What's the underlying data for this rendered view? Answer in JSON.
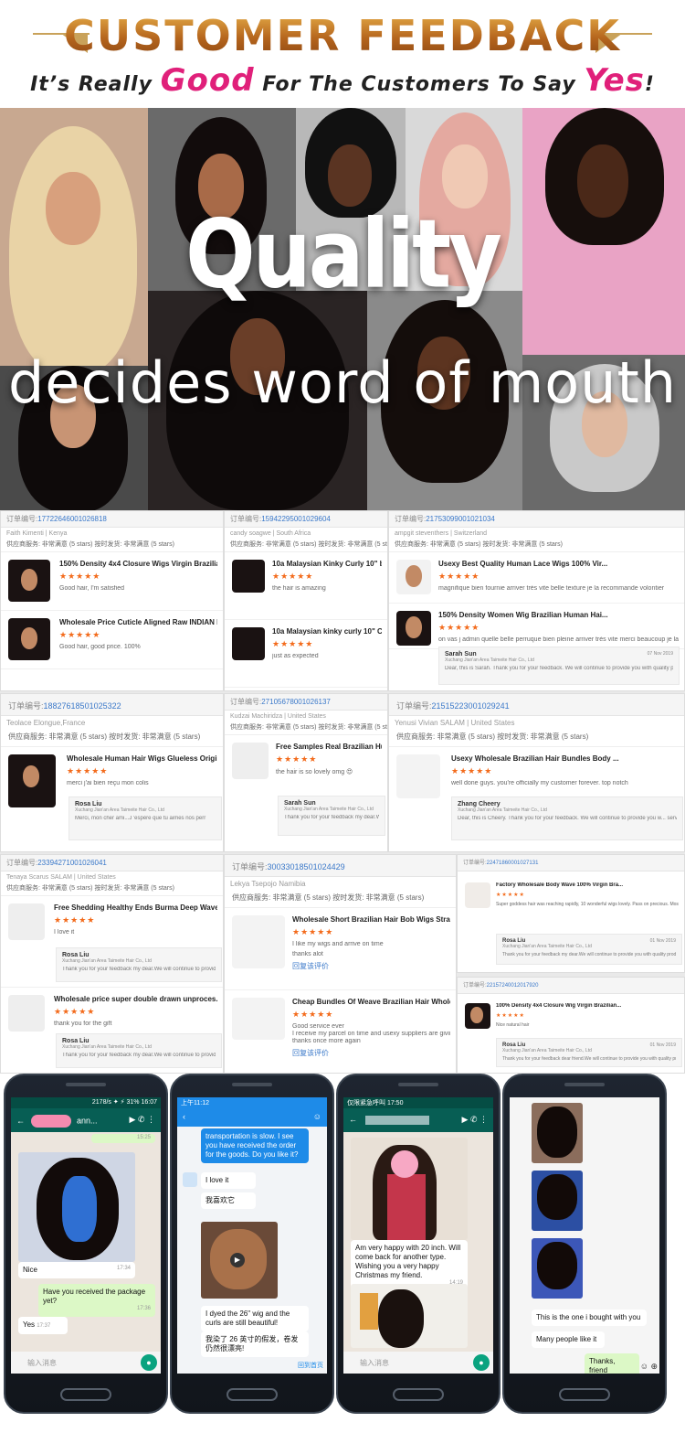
{
  "header": {
    "title": "CUSTOMER FEEDBACK",
    "subtitle_pre": "It’s Really ",
    "subtitle_em1": "Good",
    "subtitle_mid": " For The Customers To Say ",
    "subtitle_em2": "Yes",
    "subtitle_end": "!"
  },
  "hero": {
    "headline": "Quality",
    "tagline": "decides word of mouth"
  },
  "colors": {
    "accent_gold": "#c9a25a",
    "accent_pink": "#e0207a",
    "star": "#f36b1c",
    "link": "#3a78c9"
  },
  "stars": "★★★★★",
  "reviews": {
    "c1": {
      "order_label": "订单编号:",
      "order_no": "17722646001026818",
      "buyer": "Faith Kimenti | Kenya",
      "rating_row": "供应商服务: 非常满意  (5 stars)     按时发货: 非常满意  (5 stars)",
      "items": [
        {
          "title": "150% Density 4x4 Closure Wigs Virgin Brazilian...",
          "comment": "Good hair, I'm satisfied"
        },
        {
          "title": "Wholesale Price Cuticle Aligned Raw INDIAN H...",
          "comment": "Good hair, good price. 100%"
        }
      ]
    },
    "c2": {
      "order_label": "订单编号:",
      "order_no": "15942295001029604",
      "buyer": "candy soagwe | South Africa",
      "rating_row": "供应商服务: 非常满意  (5 stars)     按时发货: 非常满意  (5 stars)",
      "items": [
        {
          "title": "10a Malaysian Kinky Curly 10\" bundles",
          "comment": "the hair is amazing"
        },
        {
          "title": "10a Malaysian kinky curly 10\" Closure",
          "comment": "just as expected"
        }
      ]
    },
    "c3": {
      "order_label": "订单编号:",
      "order_no": "21753099001021034",
      "buyer": "ampgit steventhers | Switzerland",
      "rating_row": "供应商服务: 非常满意  (5 stars)     按时发货: 非常满意  (5 stars)",
      "items": [
        {
          "title": "Usexy Best Quality Human Lace Wigs 100% Vir...",
          "comment": "magnifique bien fournie arriver très vite belle texture je la recommande volontier"
        },
        {
          "title": "150% Density Women Wig Brazilian Human Hai...",
          "comment": "on vas j admin quelle belle perruque bien pleine arriver très vite merci beaucoup je la recommande très très volontier à bientôt"
        }
      ],
      "reply": {
        "name": "Sarah Sun",
        "company": "Xuchang Jian'an Area Taimeite Hair Co., Ltd",
        "date": "07 Nov 2019",
        "text": "Dear, this is Sarah. Thank you for your feedback. We will continue to provide you with quality products and services. Have a happy life."
      }
    },
    "c4": {
      "order_label": "订单编号:",
      "order_no": "18827618501025322",
      "buyer": "Teolace Elongue,France",
      "rating_row": "供应商服务: 非常满意  (5 stars)     按时发货: 非常满意  (5 stars)",
      "item": {
        "title": "Wholesale Human Hair Wigs Glueless Original ...",
        "comment": "merci j'ai bien reçu mon colis"
      },
      "reply": {
        "name": "Rosa Liu",
        "company": "Xuchang Jian'an Area Taimeite Hair Co., Ltd",
        "text": "Merci, mon cher ami...J 'espère que tu aimes nos perr"
      }
    },
    "c5": {
      "order_label": "订单编号:",
      "order_no": "27105678001026137",
      "buyer": "Kudzai Machiridza | United States",
      "rating_row": "供应商服务: 非常满意  (5 stars)     按时发货: 非常满意  (5 stars)",
      "item": {
        "title": "Free Samples Real Brazilian Human Hair Bu...",
        "comment": "the hair is so lovely omg 😍"
      },
      "reply": {
        "name": "Sarah Sun",
        "company": "Xuchang Jian'an Area Taimeite Hair Co., Ltd",
        "text": "Thank you for your feedback my dear.We will co... Have a happy life."
      }
    },
    "c6": {
      "order_label": "订单编号:",
      "order_no": "21515223001029241",
      "buyer": "Yenusi Vivian SALAM | United States",
      "rating_row": "供应商服务: 非常满意  (5 stars)     按时发货: 非常满意  (5 stars)",
      "item": {
        "title": "Usexy Wholesale Brazilian Hair Bundles Body ...",
        "comment": "well done guys. you're officially my customer forever. top notch"
      },
      "reply": {
        "name": "Zhang Cheery",
        "company": "Xuchang Jian'an Area Taimeite Hair Co., Ltd",
        "text": "Dear, this is Cheery. Thank you for your feedback. We will continue to provide you w... services. Have a happy life."
      }
    },
    "c7": {
      "order_label": "订单编号:",
      "order_no": "23394271001026041",
      "buyer": "Tenaya Scarus SALAM | United States",
      "rating_row": "供应商服务: 非常满意  (5 stars)     按时发货: 非常满意  (5 stars)",
      "items": [
        {
          "title": "Free Shedding Healthy Ends Burma Deep Wave...",
          "comment": "I love it"
        },
        {
          "title": "Wholesale price super double drawn unproces...",
          "comment": "thank you for the gift"
        }
      ],
      "reply1": {
        "name": "Rosa Liu",
        "company": "Xuchang Jian'an Area Taimeite Hair Co., Ltd",
        "text": "Thank you for your feedback my dear.We will continue to provide you with q... a happy life."
      },
      "reply2": {
        "name": "Rosa Liu",
        "company": "Xuchang Jian'an Area Taimeite Hair Co., Ltd",
        "text": "Thank you for your feedback my dear.We will continue to provide you with q... Have a happy life."
      }
    },
    "c8": {
      "order_label": "订单编号:",
      "order_no": "30033018501024429",
      "buyer": "Lekya Tsepojo Namibia",
      "rating_row": "供应商服务: 非常满意  (5 stars)     按时发货: 非常满意  (5 stars)",
      "items": [
        {
          "title": "Wholesale Short Brazilian Hair Bob Wigs Straig...",
          "comment": "I like my wigs and arrive on time",
          "comment2": "thanks alot",
          "link": "回复该评价"
        },
        {
          "title": "Cheap Bundles Of Weave Brazilian Hair Wholes...",
          "comment": "Good service ever",
          "comment2": "I receive my parcel on time and usexy suppliers are giving go",
          "comment3": "thanks once more again",
          "link": "回复该评价"
        }
      ]
    },
    "c9": {
      "order_label": "订单编号:",
      "order_no": "22471860001027131",
      "item": {
        "title": "Factory Wholesale Body Wave 100% Virgin Bra...",
        "comment": "Super goddess hair was reaching rapidly, 10 wonderful wigs lovely. Pass on precious. Most quickly a hand. Take a fin sumer. Quit no."
      },
      "reply": {
        "name": "Rosa Liu",
        "company": "Xuchang Jian'an Area Taimeite Hair Co., Ltd",
        "date": "01 Nov 2019",
        "text": "Thank you for your feedback my dear.We will continue to provide you with quality products and services."
      }
    },
    "c10": {
      "order_label": "订单编号:",
      "order_no": "22157240012017920",
      "item": {
        "title": "100% Density 4x4 Closure Wig Virgin Brazilian...",
        "comment": "Nice natural hair"
      },
      "reply": {
        "name": "Rosa Liu",
        "company": "Xuchang Jian'an Area Taimeite Hair Co., Ltd",
        "date": "01 Nov 2019",
        "text": "Thank you for your feedback dear friend.We will continue to provide you with quality products and services."
      }
    }
  },
  "phones": {
    "p1": {
      "status": "2178/s  ✦  ⚡  31%  16:07",
      "contact": "ann...",
      "time_top": "15:25",
      "msg_nice": "Nice",
      "msg_nice_time": "17:34",
      "msg_q": "Have you received the package yet?",
      "msg_q_time": "17:36",
      "msg_yes": "Yes",
      "msg_yes_time": "17:37",
      "input_placeholder": "输入消息"
    },
    "p2": {
      "status": "上午11:12",
      "msg_transport": "transportation is slow. I see you have received the order for the goods. Do you like it?",
      "msg_love": "I love it",
      "msg_love_cn": "我喜欢它",
      "msg_dyed": "I dyed the 26\" wig and the curls are still beautiful!",
      "msg_dyed_cn": "我染了 26 英寸的假发，卷发仍然很漂亮!",
      "back_label": "回到首页"
    },
    "p3": {
      "status": "仅限紧急呼叫  17:50",
      "msg_happy": "Am very happy with 20 inch. Will come back for another type. Wishing you a very happy Christmas my friend.",
      "msg_happy_time": "14:19",
      "input_placeholder": "输入消息"
    },
    "p4": {
      "msg_one": "This is the one i bought with you",
      "msg_many": "Many people like it",
      "msg_thanks": "Thanks, friend"
    }
  }
}
